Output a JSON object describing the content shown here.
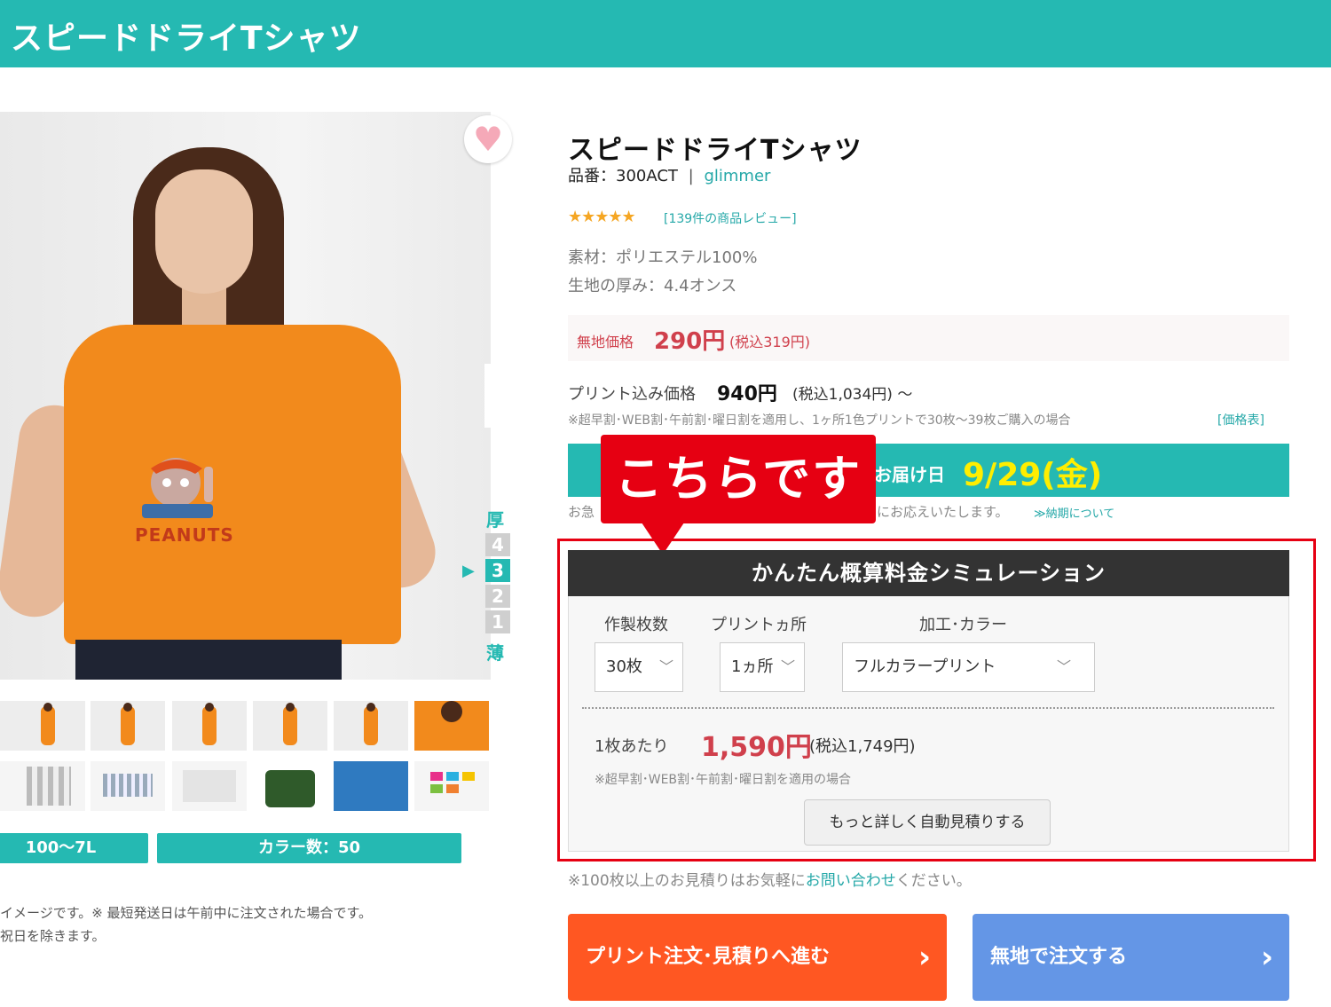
{
  "banner": {
    "title": "スピードドライTシャツ"
  },
  "product": {
    "title": "スピードドライTシャツ",
    "item_no_label": "品番：300ACT",
    "separator": "|",
    "brand": "glimmer",
    "stars": "★★★★★",
    "rating_fraction": 1.0,
    "reviews_link": "[139件の商品レビュー]",
    "material": "素材：ポリエステル100%",
    "thickness_spec": "生地の厚み：4.4オンス"
  },
  "image": {
    "print_logo": "PEANUTS",
    "favorite_icon": "heart-icon"
  },
  "thickness_scale": {
    "top_label": "厚",
    "bottom_label": "薄",
    "levels": [
      "4",
      "3",
      "2",
      "1"
    ],
    "active_level": "3",
    "arrow": "▶"
  },
  "info_pills": {
    "sizes": "100〜7L",
    "colors": "カラー数：50"
  },
  "left_notes": {
    "line1": "イメージです。※ 最短発送日は午前中に注文された場合です。",
    "line2": "祝日を除きます。"
  },
  "plain_price": {
    "label": "無地価格",
    "price": "290円",
    "tax": "(税込319円)"
  },
  "print_price": {
    "label": "プリント込み価格",
    "price": "940円",
    "tax": "(税込1,034円) 〜",
    "note": "※超早割･WEB割･午前割･曜日割を適用し、1ヶ所1色プリントで30枚〜39枚ご購入の場合",
    "table_link": "[価格表]"
  },
  "delivery": {
    "label": "お届け日",
    "date": "9/29(金)",
    "note_left": "お急",
    "note_right": "にお応えいたします。",
    "link": "≫納期について"
  },
  "callout": {
    "text": "こちらです"
  },
  "simulation": {
    "title": "かんたん概算料金シミュレーション",
    "quantity_label": "作製枚数",
    "location_label": "プリントヵ所",
    "process_label": "加工･カラー",
    "quantity_value": "30枚",
    "location_value": "1ヵ所",
    "process_value": "フルカラープリント",
    "unit_label": "1枚あたり",
    "unit_price": "1,590円",
    "unit_tax": "(税込1,749円)",
    "note": "※超早割･WEB割･午前割･曜日割を適用の場合",
    "detail_button": "もっと詳しく自動見積りする"
  },
  "bulk": {
    "prefix": "※100枚以上のお見積りはお気軽に",
    "link": "お問い合わせ",
    "suffix": "ください。"
  },
  "cta": {
    "print_order": "プリント注文･見積りへ進む",
    "plain_order": "無地で注文する",
    "arrow": "›"
  },
  "colors": {
    "brand_teal": "#25b9b2",
    "price_red": "#d0404c",
    "callout_red": "#e60012",
    "cta_orange": "#ff5722",
    "cta_blue": "#6496e6",
    "shirt_orange": "#f28a1c"
  }
}
